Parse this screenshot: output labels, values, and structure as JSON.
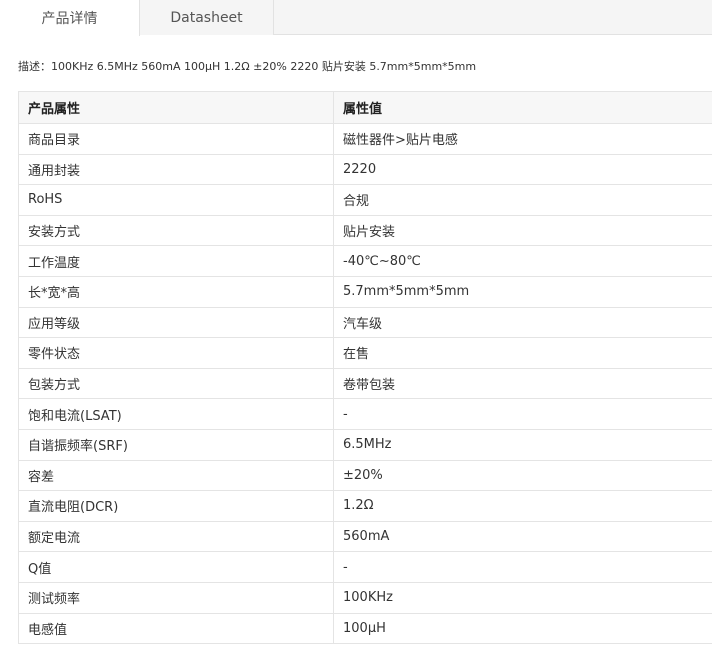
{
  "tabs": [
    {
      "label": "产品详情",
      "active": true
    },
    {
      "label": "Datasheet",
      "active": false
    }
  ],
  "description": "描述：100KHz 6.5MHz 560mA 100μH 1.2Ω ±20% 2220 贴片安装 5.7mm*5mm*5mm",
  "table": {
    "headers": [
      "产品属性",
      "属性值"
    ],
    "rows": [
      [
        "商品目录",
        "磁性器件>贴片电感"
      ],
      [
        "通用封装",
        "2220"
      ],
      [
        "RoHS",
        "合规"
      ],
      [
        "安装方式",
        "贴片安装"
      ],
      [
        "工作温度",
        "-40℃~80℃"
      ],
      [
        "长*宽*高",
        "5.7mm*5mm*5mm"
      ],
      [
        "应用等级",
        "汽车级"
      ],
      [
        "零件状态",
        "在售"
      ],
      [
        "包装方式",
        "卷带包装"
      ],
      [
        "饱和电流(LSAT)",
        "-"
      ],
      [
        "自谐振频率(SRF)",
        "6.5MHz"
      ],
      [
        "容差",
        "±20%"
      ],
      [
        "直流电阻(DCR)",
        "1.2Ω"
      ],
      [
        "额定电流",
        "560mA"
      ],
      [
        "Q值",
        "-"
      ],
      [
        "测试频率",
        "100KHz"
      ],
      [
        "电感值",
        "100μH"
      ]
    ]
  }
}
